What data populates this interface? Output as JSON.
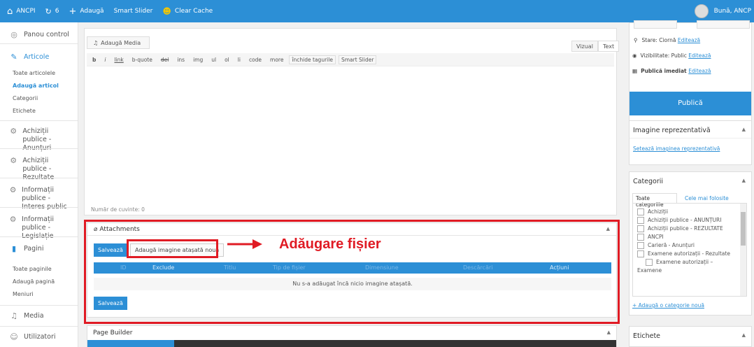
{
  "adminbar": {
    "site": "ANCPI",
    "updates": "6",
    "new": "Adaugă",
    "slider": "Smart Slider",
    "cache": "Clear Cache",
    "greeting": "Bună, ANCP"
  },
  "menu": {
    "dashboard": "Panou control",
    "articles": "Articole",
    "all_articles": "Toate articolele",
    "add_article": "Adaugă articol",
    "categories": "Categorii",
    "tags": "Etichete",
    "acq1": "Achiziții publice -",
    "acq1b": "Anunțuri",
    "acq2": "Achiziții publice -",
    "acq2b": "Rezultate",
    "info1": "Informații publice -",
    "info1b": "Interes public",
    "info2": "Informații publice -",
    "info2b": "Legislație",
    "pages": "Pagini",
    "all_pages": "Toate paginile",
    "add_page": "Adaugă pagină",
    "menus": "Meniuri",
    "media": "Media",
    "users": "Utilizatori"
  },
  "editor": {
    "add_media": "Adaugă Media",
    "visual": "Vizual",
    "text": "Text",
    "toolbar": [
      "b",
      "i",
      "link",
      "b-quote",
      "del",
      "ins",
      "img",
      "ul",
      "ol",
      "li",
      "code",
      "more",
      "închide tagurile",
      "Smart Slider"
    ],
    "wordcount": "Număr de cuvinte: 0"
  },
  "attachments": {
    "title": "Attachments",
    "save": "Salvează",
    "add_new": "Adaugă imagine atașată nouă",
    "columns": [
      "ID",
      "Exclude",
      "Titlu",
      "Tip de fișier",
      "Dimensiune",
      "Descărcări",
      "Acțiuni"
    ],
    "empty": "Nu s-a adăugat încă nicio imagine atașată.",
    "save2": "Salvează"
  },
  "annotation": "Adăugare fișier",
  "pagebuilder": {
    "title": "Page Builder"
  },
  "publish": {
    "status_label": "Stare: Ciornă",
    "status_link": "Editează",
    "visibility_label": "Vizibilitate: Public",
    "visibility_link": "Editează",
    "date_label": "Publică imediat",
    "date_link": "Editează",
    "publish_btn": "Publică"
  },
  "featured": {
    "title": "Imagine reprezentativă",
    "link": "Setează imaginea reprezentativă"
  },
  "categories": {
    "title": "Categorii",
    "tab_all": "Toate categoriile",
    "tab_popular": "Cele mai folosite",
    "items": [
      "Achiziții",
      "Achiziții publice - ANUNȚURI",
      "Achiziții publice - REZULTATE",
      "ANCPI",
      "Carieră - Anunțuri",
      "Examene autorizații - Rezultate"
    ],
    "sub_item": "Examene autorizații –",
    "sub_item2": "Examene",
    "add_new": "+ Adaugă o categorie nouă"
  },
  "tags": {
    "title": "Etichete"
  },
  "colors": {
    "accent": "#2c8fd6",
    "highlight": "#e01b24"
  }
}
